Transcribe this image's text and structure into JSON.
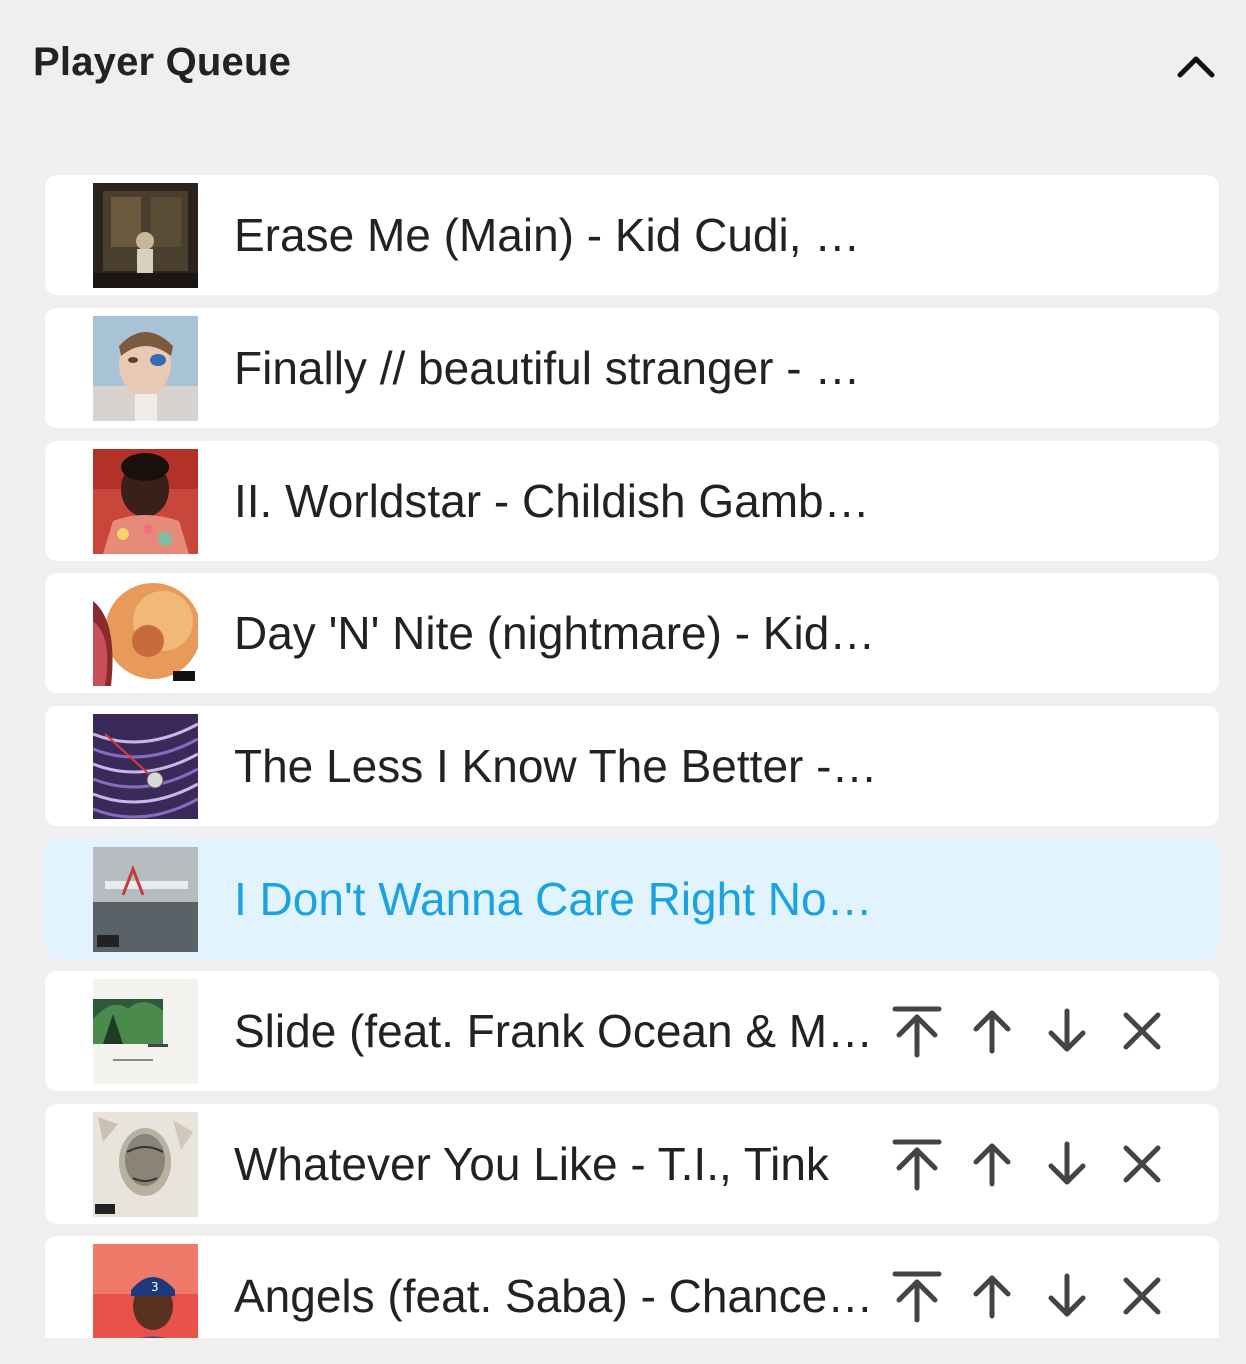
{
  "header": {
    "title": "Player Queue",
    "collapse_icon": "chevron-up-icon"
  },
  "queue": {
    "items": [
      {
        "track": "Erase Me (Main) - Kid Cudi, …",
        "art": "album-art-man-on-the-moon-ii",
        "active": false,
        "actions": false
      },
      {
        "track": "Finally // beautiful stranger - …",
        "art": "album-art-badlands",
        "active": false,
        "actions": false
      },
      {
        "track": "II. Worldstar - Childish Gamb…",
        "art": "album-art-because-the-internet",
        "active": false,
        "actions": false
      },
      {
        "track": "Day 'N' Nite (nightmare) - Kid…",
        "art": "album-art-man-on-the-moon",
        "active": false,
        "actions": false
      },
      {
        "track": "The Less I Know The Better -…",
        "art": "album-art-currents",
        "active": false,
        "actions": false
      },
      {
        "track": "I Don't Wanna Care Right No…",
        "art": "album-art-lasers",
        "active": true,
        "actions": false
      },
      {
        "track": "Slide (feat. Frank Ocean & M…",
        "art": "album-art-slide",
        "active": false,
        "actions": true
      },
      {
        "track": "Whatever You Like - T.I., Tink",
        "art": "album-art-paper-trail",
        "active": false,
        "actions": true
      },
      {
        "track": "Angels (feat. Saba) - Chance…",
        "art": "album-art-coloring-book",
        "active": false,
        "actions": true
      }
    ],
    "action_icons": [
      "move-to-top-icon",
      "move-up-icon",
      "move-down-icon",
      "remove-icon"
    ]
  },
  "colors": {
    "background": "#efefef",
    "row": "#ffffff",
    "active_row": "#e1f3fc",
    "active_text": "#1aa3e0",
    "text": "#222222",
    "icon": "#444444"
  }
}
